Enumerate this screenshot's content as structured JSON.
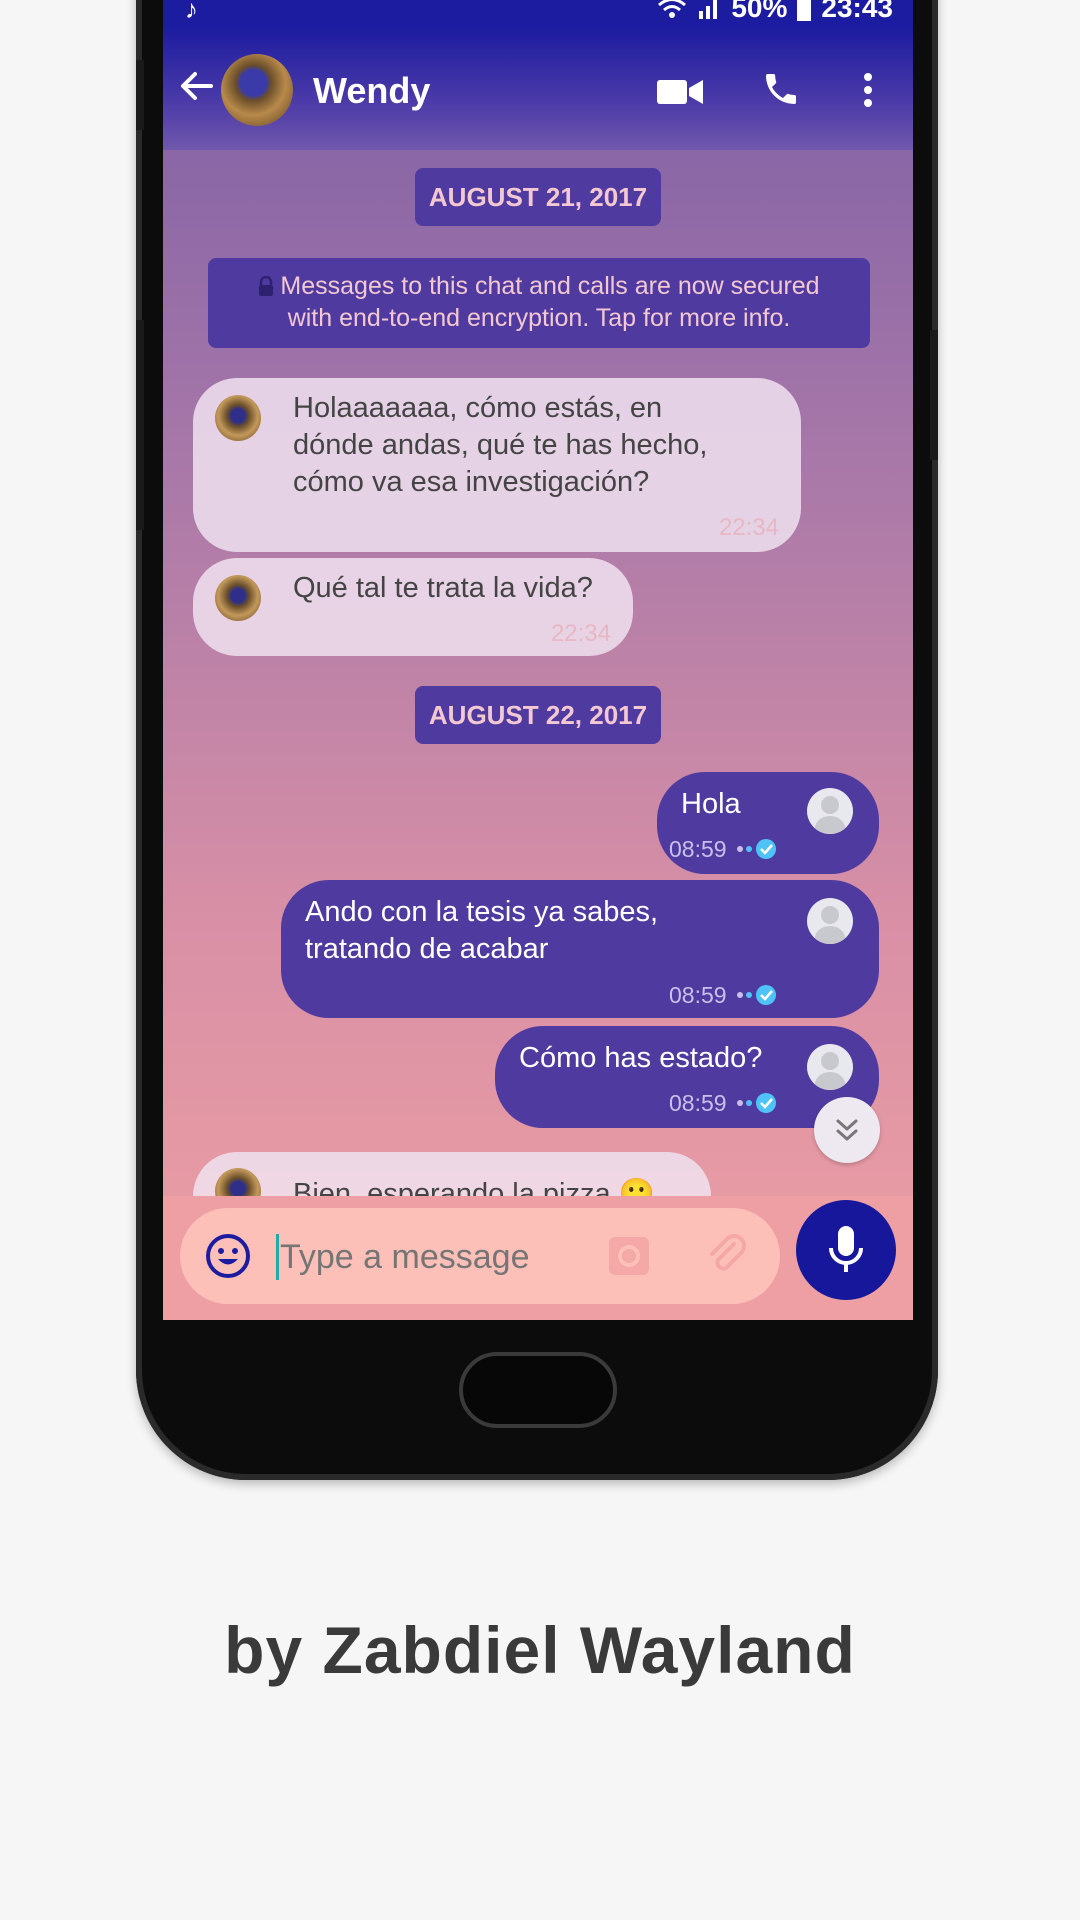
{
  "status_bar": {
    "battery": "50%",
    "time": "23:43"
  },
  "header": {
    "contact_name": "Wendy"
  },
  "chat": {
    "date_1": "AUGUST 21, 2017",
    "encryption_notice_line1": "Messages to this chat and calls are now secured",
    "encryption_notice_line2": "with end-to-end encryption. Tap for more info.",
    "in_1_line1": "Holaaaaaaa, cómo estás, en",
    "in_1_line2": "dónde andas, qué te has hecho,",
    "in_1_line3": "cómo va esa investigación?",
    "in_1_time": "22:34",
    "in_2_text": "Qué tal te trata la vida?",
    "in_2_time": "22:34",
    "date_2": "AUGUST 22, 2017",
    "out_1_text": "Hola",
    "out_1_time": "08:59",
    "out_2_line1": "Ando con la tesis ya sabes,",
    "out_2_line2": "tratando de acabar",
    "out_2_time": "08:59",
    "out_3_text": "Cómo has estado?",
    "out_3_time": "08:59",
    "in_3_text": "Bien, esperando la pizza",
    "in_3_emoji": "🙂"
  },
  "composer": {
    "placeholder": "Type a message",
    "value": ""
  },
  "footer": {
    "credit": "by Zabdiel Wayland"
  },
  "colors": {
    "header_blue": "#1c1ca0",
    "bubble_out": "#4f3ba0",
    "mic_button": "#16179a",
    "read_tick": "#4fc3f7"
  },
  "icons": [
    "music-note-icon",
    "wifi-icon",
    "signal-icon",
    "battery-icon",
    "back-arrow-icon",
    "video-call-icon",
    "phone-call-icon",
    "more-vertical-icon",
    "lock-icon",
    "double-check-icon",
    "chevron-double-down-icon",
    "emoji-icon",
    "camera-icon",
    "attach-icon",
    "mic-icon"
  ]
}
